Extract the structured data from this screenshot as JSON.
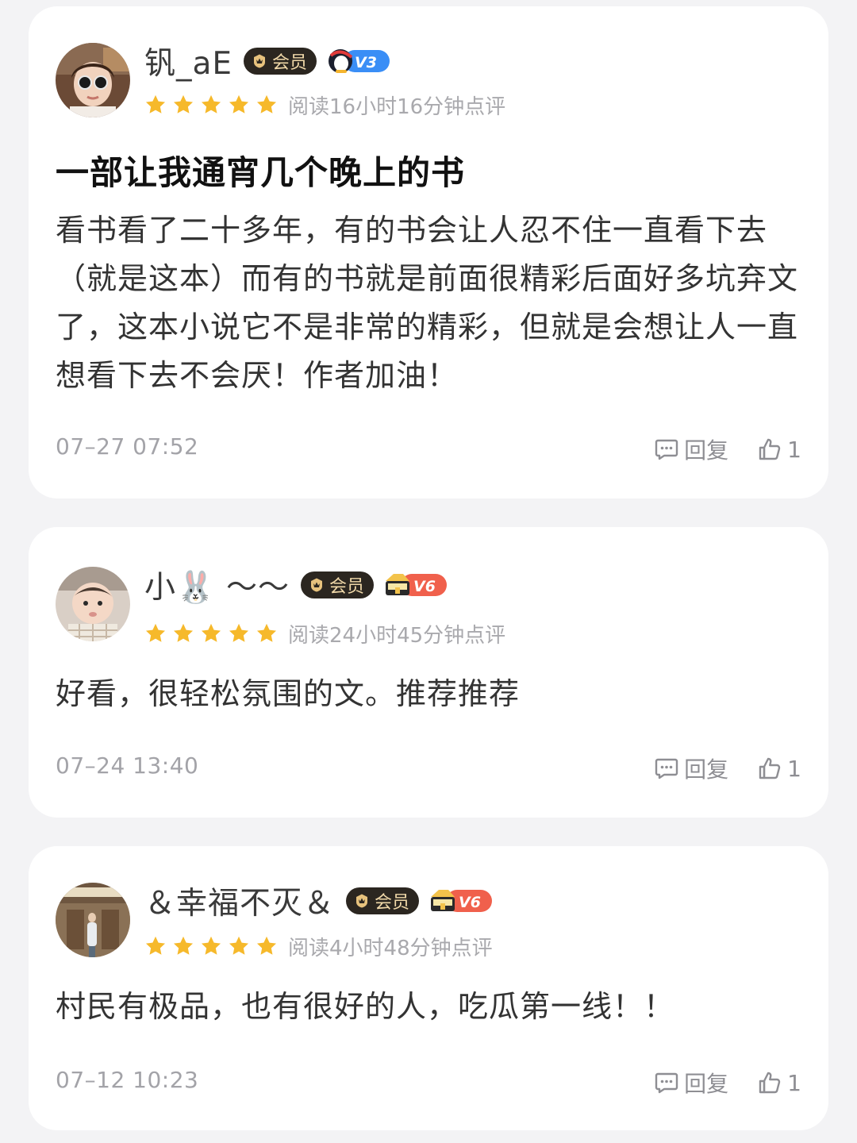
{
  "reviews": [
    {
      "username": "钒_aE",
      "member_label": "会员",
      "level": "V3",
      "level_color": "#3a8ef6",
      "stars": 5,
      "read_time": "阅读16小时16分钟点评",
      "title": "一部让我通宵几个晚上的书",
      "body": "看书看了二十多年，有的书会让人忍不住一直看下去（就是这本）而有的书就是前面很精彩后面好多坑弃文了，这本小说它不是非常的精彩，但就是会想让人一直想看下去不会厌！作者加油！",
      "date": "07–27 07:52",
      "reply_label": "回复",
      "like_count": "1"
    },
    {
      "username": "小🐰 ～～",
      "member_label": "会员",
      "level": "V6",
      "level_color": "#f0604c",
      "stars": 5,
      "read_time": "阅读24小时45分钟点评",
      "title": "",
      "body": "好看，很轻松氛围的文。推荐推荐",
      "date": "07–24 13:40",
      "reply_label": "回复",
      "like_count": "1"
    },
    {
      "username": "＆幸福不灭＆",
      "member_label": "会员",
      "level": "V6",
      "level_color": "#f0604c",
      "stars": 5,
      "read_time": "阅读4小时48分钟点评",
      "title": "",
      "body": "村民有极品，也有很好的人，吃瓜第一线！！",
      "date": "07–12 10:23",
      "reply_label": "回复",
      "like_count": "1"
    }
  ],
  "colors": {
    "star": "#f6b92b",
    "member_bg": "#2b2620",
    "member_text": "#f1d9a9"
  }
}
